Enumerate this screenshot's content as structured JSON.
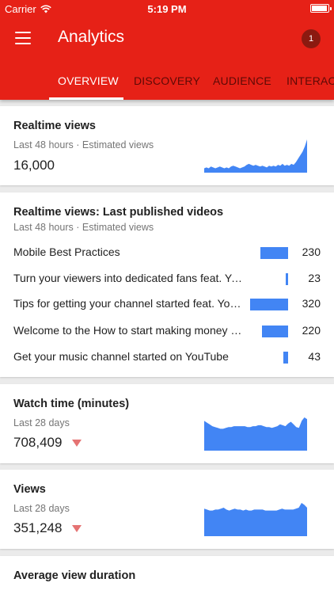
{
  "status_bar": {
    "carrier": "Carrier",
    "time": "5:19 PM"
  },
  "app_bar": {
    "title": "Analytics",
    "notification_count": "1"
  },
  "tabs": [
    {
      "label": "OVERVIEW",
      "active": true
    },
    {
      "label": "DISCOVERY",
      "active": false
    },
    {
      "label": "AUDIENCE",
      "active": false
    },
    {
      "label": "INTERACT",
      "active": false
    }
  ],
  "realtime": {
    "title": "Realtime views",
    "subtitle": "Last 48 hours · Estimated views",
    "value": "16,000"
  },
  "latest_videos": {
    "title": "Realtime views: Last published videos",
    "subtitle": "Last 48 hours · Estimated views",
    "max_value": 320,
    "items": [
      {
        "title": "Mobile Best Practices",
        "count": "230",
        "value": 230
      },
      {
        "title": "Turn your viewers into dedicated fans feat. YouTube Creator Academy",
        "count": "23",
        "value": 23
      },
      {
        "title": "Tips for getting your channel started feat. YouTube Creator Academy",
        "count": "320",
        "value": 320
      },
      {
        "title": "Welcome to the How to start making money on YouTube",
        "count": "220",
        "value": 220
      },
      {
        "title": "Get your music channel started on YouTube",
        "count": "43",
        "value": 43
      }
    ]
  },
  "watch_time": {
    "title": "Watch time (minutes)",
    "subtitle": "Last 28 days",
    "value": "708,409",
    "trend": "down"
  },
  "views": {
    "title": "Views",
    "subtitle": "Last 28 days",
    "value": "351,248",
    "trend": "down"
  },
  "avg_duration": {
    "title": "Average view duration"
  },
  "colors": {
    "brand_red": "#e62117",
    "spark_blue": "#4285f4",
    "trend_down": "#e57373"
  },
  "sparklines": {
    "realtime": [
      5,
      6,
      5,
      7,
      6,
      5,
      6,
      7,
      6,
      5,
      6,
      5,
      7,
      8,
      7,
      6,
      5,
      6,
      7,
      9,
      10,
      9,
      8,
      9,
      8,
      7,
      8,
      7,
      6,
      8,
      7,
      8,
      7,
      9,
      8,
      10,
      8,
      9,
      8,
      10,
      9,
      12,
      16,
      20,
      24,
      30,
      38
    ],
    "watch_time": [
      34,
      32,
      30,
      28,
      27,
      26,
      25,
      25,
      26,
      27,
      27,
      28,
      28,
      28,
      28,
      28,
      27,
      27,
      28,
      28,
      29,
      29,
      28,
      27,
      27,
      26,
      27,
      28,
      30,
      29,
      28,
      31,
      33,
      30,
      27,
      26,
      34,
      38,
      36
    ],
    "views": [
      29,
      28,
      27,
      27,
      28,
      28,
      29,
      30,
      28,
      27,
      28,
      29,
      28,
      28,
      27,
      28,
      27,
      27,
      28,
      28,
      28,
      28,
      27,
      27,
      27,
      27,
      27,
      28,
      29,
      28,
      28,
      28,
      28,
      29,
      30,
      35,
      33,
      30
    ]
  }
}
